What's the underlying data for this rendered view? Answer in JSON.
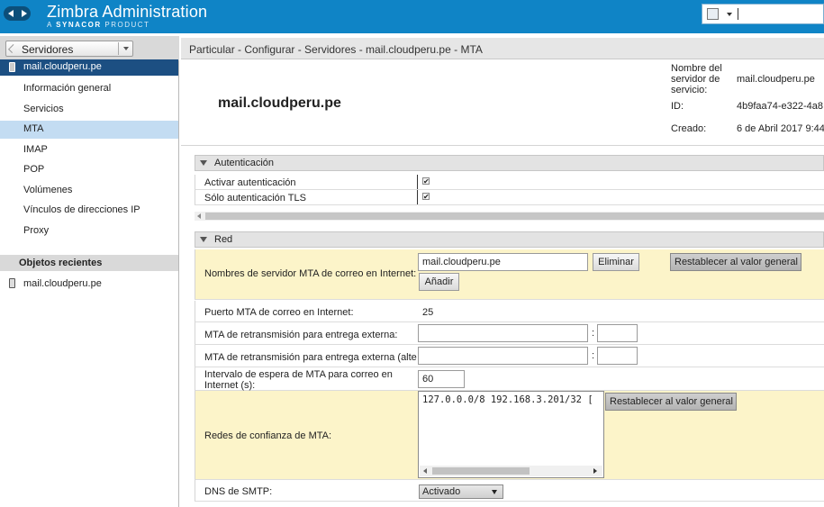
{
  "header": {
    "title": "Zimbra Administration",
    "subtitle_prefix": "A",
    "subtitle_brand": "SYNACOR",
    "subtitle_suffix": "PRODUCT",
    "accent": "#0f84c6"
  },
  "sidebar": {
    "dropdown_label": "Servidores",
    "server_name": "mail.cloudperu.pe",
    "items": [
      {
        "label": "Información general"
      },
      {
        "label": "Servicios"
      },
      {
        "label": "MTA"
      },
      {
        "label": "IMAP"
      },
      {
        "label": "POP"
      },
      {
        "label": "Volúmenes"
      },
      {
        "label": "Vínculos de direcciones IP"
      },
      {
        "label": "Proxy"
      }
    ],
    "recent_header": "Objetos recientes",
    "recent_items": [
      {
        "label": "mail.cloudperu.pe"
      }
    ]
  },
  "main": {
    "breadcrumb": "Particular - Configurar - Servidores - mail.cloudperu.pe - MTA",
    "server_title": "mail.cloudperu.pe",
    "meta": {
      "service_name_label": "Nombre del servidor de servicio:",
      "service_name_value": "mail.cloudperu.pe",
      "id_label": "ID:",
      "id_value": "4b9faa74-e322-4a8",
      "created_label": "Creado:",
      "created_value": "6 de Abril 2017 9:44"
    },
    "auth": {
      "title": "Autenticación",
      "enable_label": "Activar autenticación",
      "tls_label": "Sólo autenticación TLS",
      "check_glyph": "✔"
    },
    "net": {
      "title": "Red",
      "mta_hostnames_label": "Nombres de servidor MTA de correo en Internet:",
      "mta_hostname_value": "mail.cloudperu.pe",
      "remove_button": "Eliminar",
      "reset_button": "Restablecer al valor general",
      "add_button": "Añadir",
      "mta_port_label": "Puerto MTA de correo en Internet:",
      "mta_port_value": "25",
      "relay_label": "MTA de retransmisión para entrega externa:",
      "relay_alt_label": "MTA de retransmisión para entrega externa (alte",
      "colon": ":",
      "timeout_label": "Intervalo de espera de MTA para correo en Internet (s):",
      "timeout_value": "60",
      "trusted_label": "Redes de confianza de MTA:",
      "trusted_value": "127.0.0.0/8 192.168.3.201/32 [",
      "reset_button2": "Restablecer al valor general",
      "dns_label": "DNS de SMTP:",
      "dns_value": "Activado"
    }
  }
}
